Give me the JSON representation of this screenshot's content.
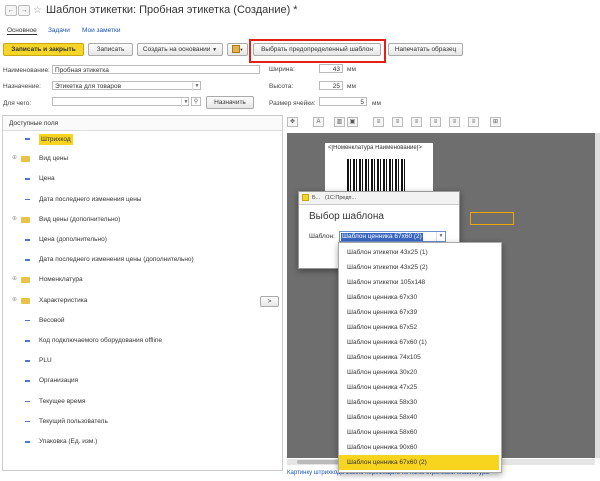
{
  "window": {
    "title": "Шаблон этикетки: Пробная этикетка (Создание) *",
    "nav_back": "←",
    "nav_forward": "→",
    "star": "☆"
  },
  "tabs": [
    {
      "label": "Основное"
    },
    {
      "label": "Задачи"
    },
    {
      "label": "Мои заметки"
    }
  ],
  "toolbar": {
    "save_close": "Записать и закрыть",
    "save": "Записать",
    "create_based": "Создать на основании",
    "select_predefined": "Выбрать предопределенный шаблон",
    "print_sample": "Напечатать образец"
  },
  "form": {
    "name_label": "Наименование:",
    "name_value": "Пробная этикетка",
    "purpose_label": "Назначение:",
    "purpose_value": "Этикетка для товаров",
    "for_label": "Для чего:",
    "assign_btn": "Назначить",
    "width_label": "Ширина:",
    "width_value": "43",
    "height_label": "Высота:",
    "height_value": "25",
    "cell_label": "Размер ячейки:",
    "cell_value": "5",
    "unit": "мм"
  },
  "fields_panel": {
    "header": "Доступные поля",
    "items": [
      {
        "label": "Штрихкод",
        "type": "field",
        "selected": true
      },
      {
        "label": "Вид цены",
        "type": "folder"
      },
      {
        "label": "Цена",
        "type": "field"
      },
      {
        "label": "Дата последнего изменения цены",
        "type": "field"
      },
      {
        "label": "Вид цены (дополнительно)",
        "type": "folder"
      },
      {
        "label": "Цена (дополнительно)",
        "type": "field"
      },
      {
        "label": "Дата последнего изменения цены (дополнительно)",
        "type": "field"
      },
      {
        "label": "Номенклатура",
        "type": "folder"
      },
      {
        "label": "Характеристика",
        "type": "folder"
      },
      {
        "label": "Весовой",
        "type": "field"
      },
      {
        "label": "Код подключаемого оборудования offline",
        "type": "field"
      },
      {
        "label": "PLU",
        "type": "field"
      },
      {
        "label": "Организация",
        "type": "field"
      },
      {
        "label": "Текущее время",
        "type": "field"
      },
      {
        "label": "Текущий пользователь",
        "type": "field"
      },
      {
        "label": "Упаковка (Ед. изм.)",
        "type": "field"
      }
    ]
  },
  "canvas": {
    "label_text": "<[Номенклатура Наименование]>",
    "footer_hint": "Картинку штрихкода можно перемещать по полю стрелками клавиатуры"
  },
  "dialog": {
    "titlebar": "(1С:Предп...",
    "heading": "Выбор шаблона",
    "template_label": "Шаблон:",
    "template_value": "Шаблон ценника 67х60 (2)",
    "options": [
      "Шаблон этикетки 43х25 (1)",
      "Шаблон этикетки 43х25 (2)",
      "Шаблон этикетки 105х148",
      "Шаблон ценника 67х30",
      "Шаблон ценника 67х39",
      "Шаблон ценника 67х52",
      "Шаблон ценника 67х60 (1)",
      "Шаблон ценника 74х105",
      "Шаблон ценника 30х20",
      "Шаблон ценника 47х25",
      "Шаблон ценника 58х30",
      "Шаблон ценника 58х40",
      "Шаблон ценника 58х60",
      "Шаблон ценника 90х60",
      "Шаблон ценника 67х60 (2)"
    ]
  },
  "colors": {
    "accent": "#f5d527",
    "highlight_border": "#e32119",
    "link": "#1a55b8",
    "canvas_bg": "#6e6e6e"
  }
}
